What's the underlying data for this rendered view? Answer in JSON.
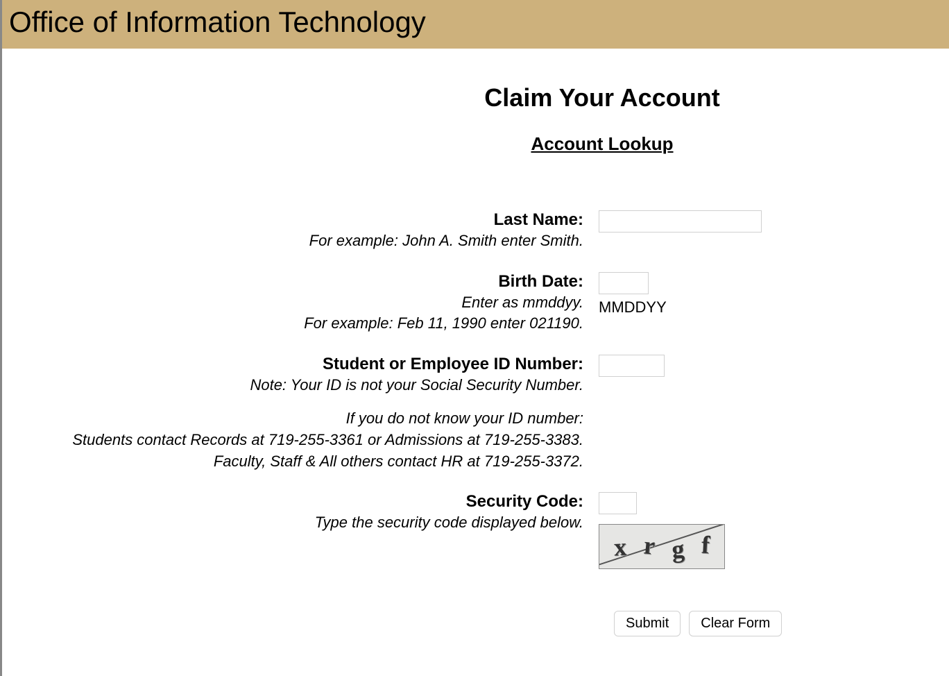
{
  "header": {
    "title": "Office of Information Technology"
  },
  "page": {
    "title": "Claim Your Account",
    "subtitle": "Account Lookup"
  },
  "form": {
    "lastname": {
      "label": "Last Name:",
      "help": "For example: John A. Smith enter Smith.",
      "value": ""
    },
    "birthdate": {
      "label": "Birth Date:",
      "help1": "Enter as mmddyy.",
      "help2": "For example: Feb 11, 1990 enter 021190.",
      "format_hint": "MMDDYY",
      "value": ""
    },
    "idnumber": {
      "label": "Student or Employee ID Number:",
      "help1": "Note: Your ID is not your Social Security Number.",
      "help2": "If you do not know your ID number:",
      "help3": "Students contact Records at 719-255-3361 or Admissions at 719-255-3383.",
      "help4": "Faculty, Staff & All others contact HR at 719-255-3372.",
      "value": ""
    },
    "securitycode": {
      "label": "Security Code:",
      "help": "Type the security code displayed below.",
      "value": "",
      "captcha": [
        "x",
        "r",
        "g",
        "f"
      ]
    },
    "buttons": {
      "submit": "Submit",
      "clear": "Clear Form"
    }
  }
}
